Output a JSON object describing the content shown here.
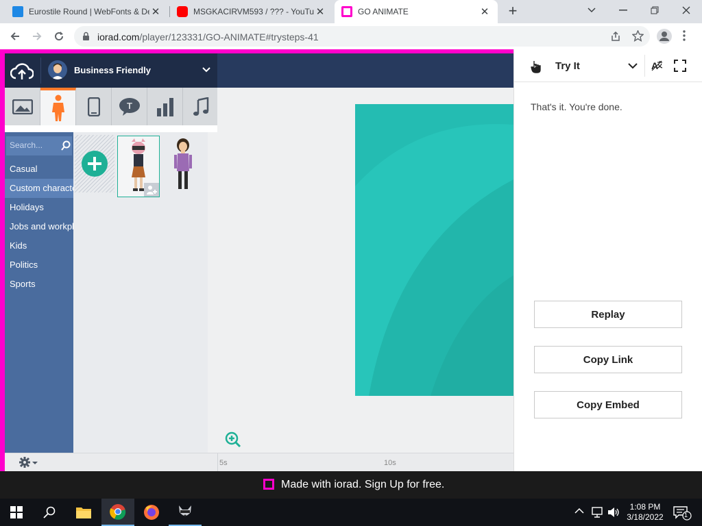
{
  "browser": {
    "tabs": [
      {
        "title": "Eurostile Round | WebFonts & De",
        "favicon_color": "#1e88e5"
      },
      {
        "title": "MSGKACIRVM593 / ??? - YouTub",
        "favicon_color": "#ff0000"
      },
      {
        "title": "GO ANIMATE",
        "favicon_color": "#ff00cc"
      }
    ],
    "url_host": "iorad.com",
    "url_path": "/player/123331/GO-ANIMATE#trysteps-41"
  },
  "goanimate": {
    "theme_name": "Business Friendly",
    "search_placeholder": "Search...",
    "categories": [
      "Casual",
      "Custom characters",
      "Holidays",
      "Jobs and workplace",
      "Kids",
      "Politics",
      "Sports"
    ],
    "timeline_marks": [
      "5s",
      "10s"
    ],
    "stage_color": "#24bcb2"
  },
  "panel": {
    "mode": "Try It",
    "message": "That's it. You're done.",
    "buttons": [
      "Replay",
      "Copy Link",
      "Copy Embed"
    ]
  },
  "iorad_bar": {
    "text": "Made with iorad. Sign Up for free."
  },
  "taskbar": {
    "time": "1:08 PM",
    "date": "3/18/2022",
    "notification_count": "1"
  }
}
